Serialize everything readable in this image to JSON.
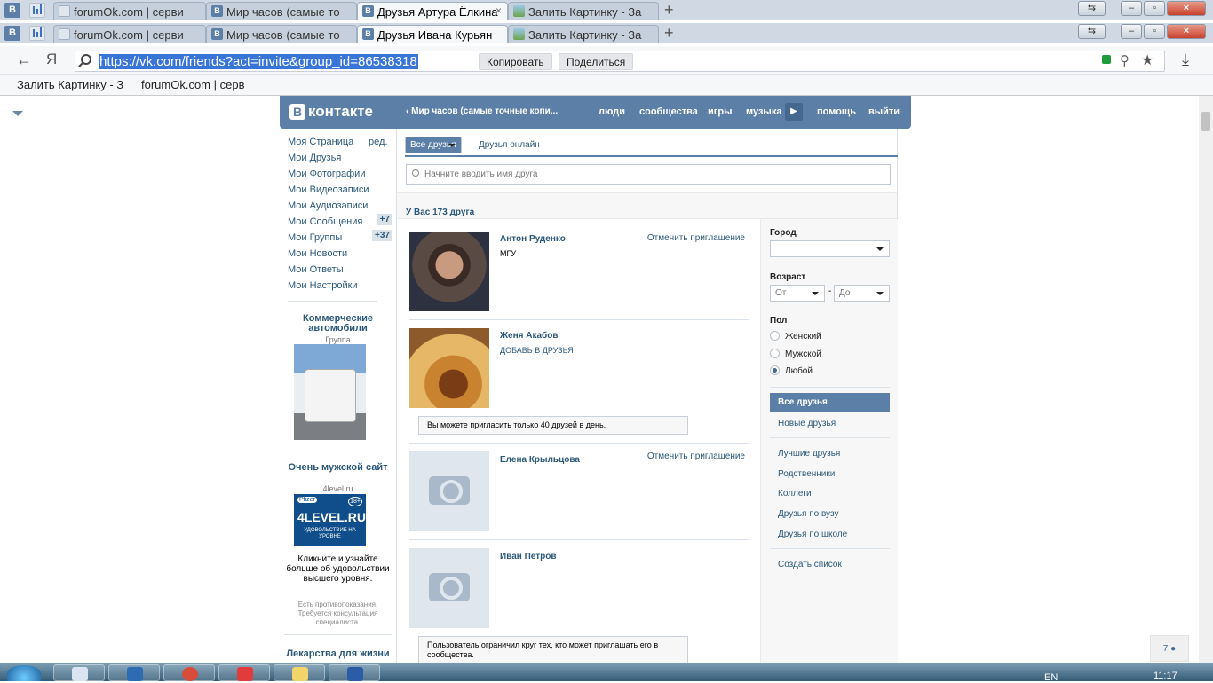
{
  "browser": {
    "tab_rows": [
      {
        "tabs": [
          {
            "title": "forumOk.com | серви",
            "icon": "bars"
          },
          {
            "title": "Мир часов (самые то",
            "icon": "vk"
          },
          {
            "title": "Друзья Артура Ёлкина",
            "icon": "vk",
            "active": true
          },
          {
            "title": "Залить Картинку - За",
            "icon": "picture"
          }
        ]
      },
      {
        "tabs": [
          {
            "title": "forumOk.com | серви",
            "icon": "bars"
          },
          {
            "title": "Мир часов (самые то",
            "icon": "vk"
          },
          {
            "title": "Друзья Ивана Курьян",
            "icon": "vk",
            "active": true
          },
          {
            "title": "Залить Картинку - За",
            "icon": "picture"
          }
        ]
      }
    ],
    "pinned_vk_label": "В",
    "new_tab": "+",
    "close_tab": "×",
    "yandex_logo": "Я",
    "url": "https://vk.com/friends?act=invite&group_id=86538318",
    "copy_button": "Копировать",
    "share_button": "Поделиться",
    "bookmarks": [
      "Залить Картинку - З",
      "forumOk.com | серв"
    ]
  },
  "vk_header": {
    "logo_letter": "В",
    "logo_text": "контакте",
    "back_link": "‹  Мир часов (самые точные копи...",
    "links": {
      "people": "люди",
      "communities": "сообщества",
      "games": "игры",
      "music": "музыка",
      "help": "помощь",
      "logout": "выйти"
    },
    "play": "▶"
  },
  "left_menu": {
    "edit": "ред.",
    "items": [
      "Моя Страница",
      "Мои Друзья",
      "Мои Фотографии",
      "Мои Видеозаписи",
      "Мои Аудиозаписи",
      "Мои Сообщения",
      "Мои Группы",
      "Мои Новости",
      "Мои Ответы",
      "Мои Настройки"
    ],
    "messages_count": "+7",
    "groups_count": "+37"
  },
  "ads": [
    {
      "title": "Коммерческие автомобили",
      "subtitle": "Группа"
    },
    {
      "title": "Очень мужской сайт",
      "subtitle": "4level.ru",
      "banner_brand": "Pfizer",
      "banner_age": "18+",
      "banner_logo": "4LEVEL.RU",
      "banner_tagline": "УДОВОЛЬСТВИЕ НА УРОВНЕ",
      "text": "Кликните и узнайте больше об удовольствии высшего уровня.",
      "disclaimer": "Есть противопоказания. Требуется консультация специалиста."
    },
    {
      "title": "Лекарства для жизни"
    }
  ],
  "tabs": {
    "all": "Все друзья",
    "online": "Друзья онлайн"
  },
  "search_placeholder": "Начните вводить имя друга",
  "friends_count": "У Вас 173 друга",
  "friends": [
    {
      "name": "Антон Руденко",
      "sub": "МГУ",
      "action": "Отменить приглашение"
    },
    {
      "name": "Женя Акабов",
      "sub": "ДОБАВЬ В ДРУЗЬЯ",
      "note": "Вы можете пригласить только 40 друзей в день."
    },
    {
      "name": "Елена Крыльцова",
      "action": "Отменить приглашение"
    },
    {
      "name": "Иван Петров",
      "note": "Пользователь ограничил круг тех, кто может приглашать его в сообщества."
    }
  ],
  "filters": {
    "city_label": "Город",
    "age_label": "Возраст",
    "age_from": "От",
    "age_dash": "-",
    "age_to": "До",
    "sex_label": "Пол",
    "female": "Женский",
    "male": "Мужской",
    "any": "Любой",
    "selected_sex": "Любой",
    "lists": [
      "Все друзья",
      "Новые друзья"
    ],
    "groups": [
      "Лучшие друзья",
      "Родственники",
      "Коллеги",
      "Друзья по вузу",
      "Друзья по школе"
    ],
    "create_list": "Создать список"
  },
  "chat_button": "7",
  "taskbar": {
    "lang": "EN",
    "time": "11:17"
  },
  "colors": {
    "vk_blue": "#5b7fa6",
    "link": "#2b587a",
    "url_highlight": "#3875d7"
  }
}
